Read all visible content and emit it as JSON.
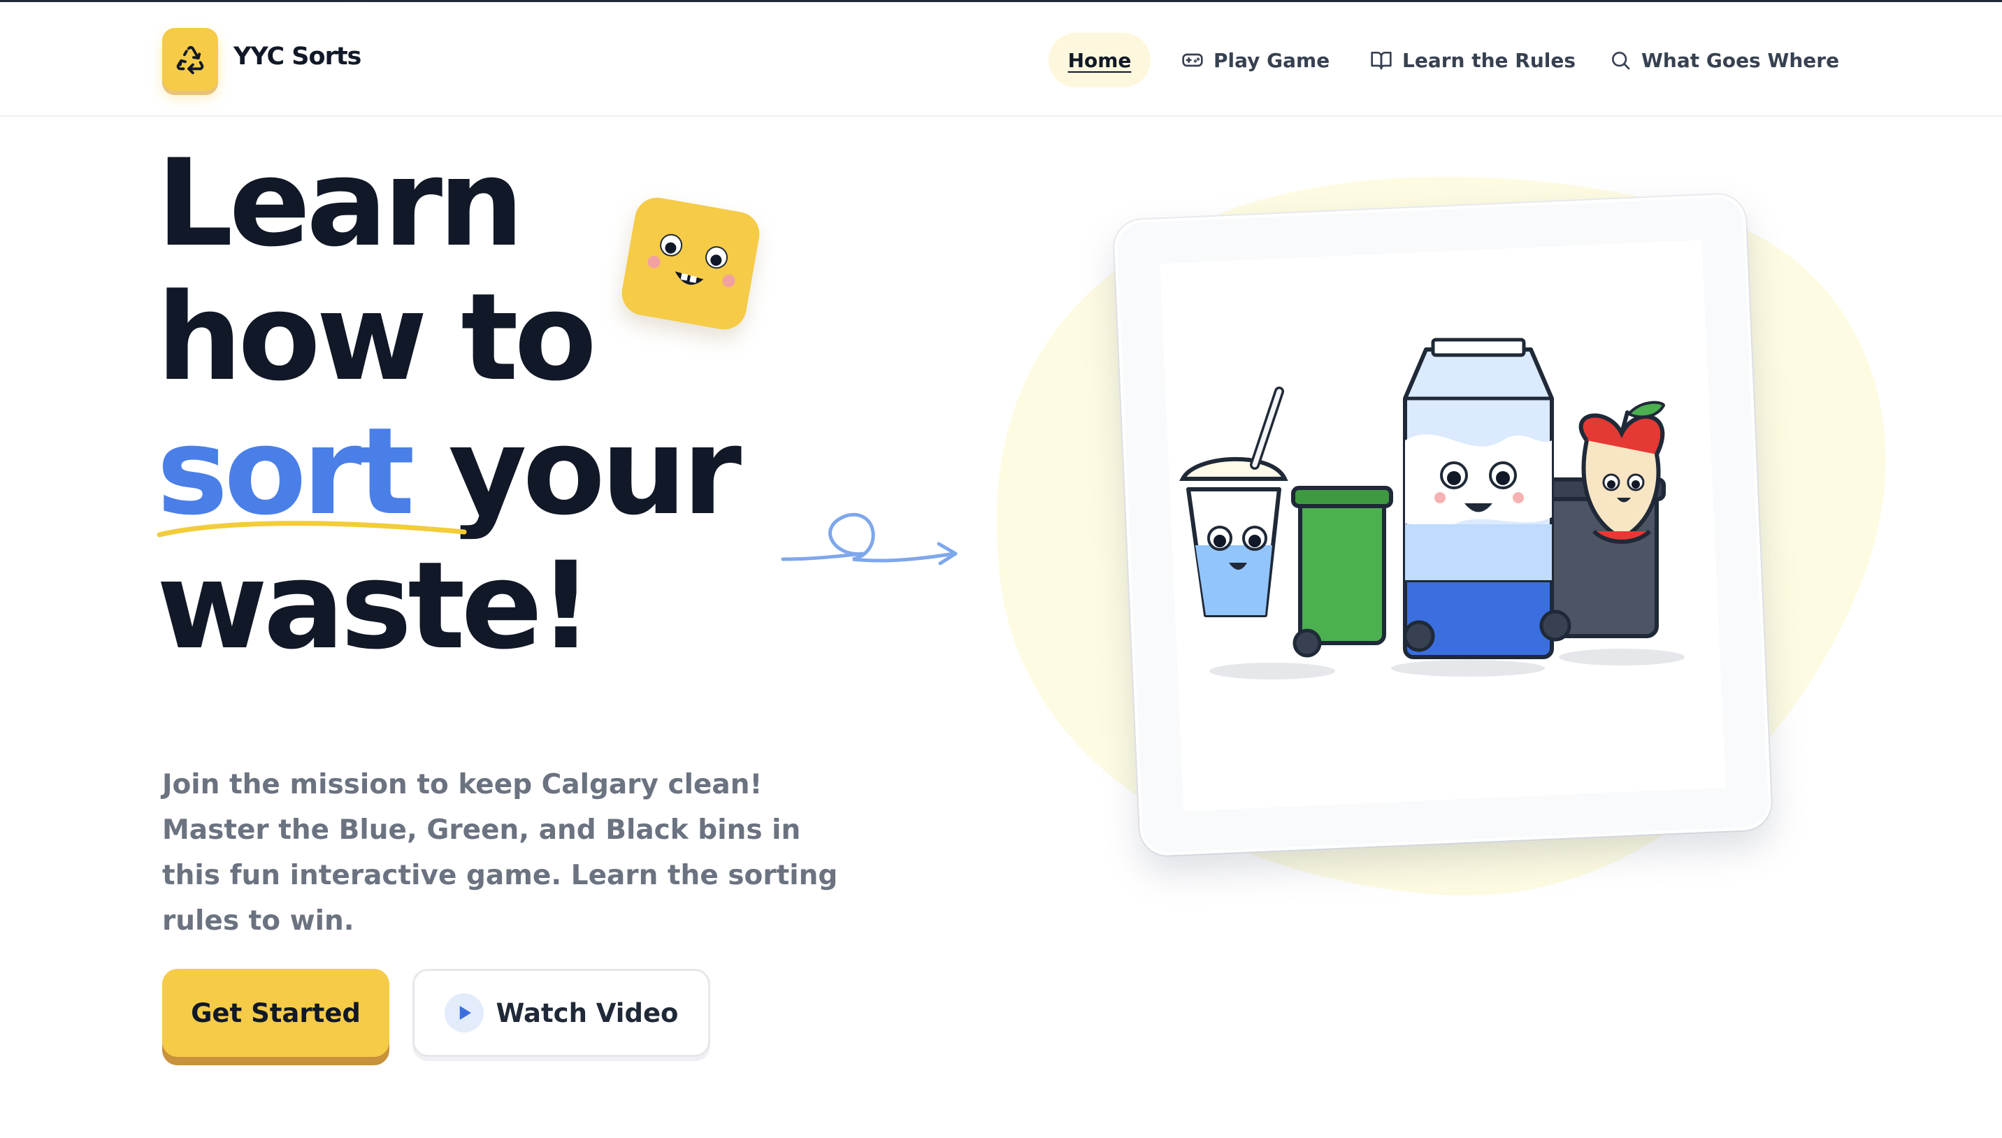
{
  "brand": {
    "name": "YYC Sorts",
    "icon": "recycle-icon",
    "color": "#f5cb47"
  },
  "nav": {
    "items": [
      {
        "label": "Home",
        "icon": "",
        "active": true
      },
      {
        "label": "Play Game",
        "icon": "gamepad-icon"
      },
      {
        "label": "Learn the Rules",
        "icon": "book-icon"
      },
      {
        "label": "What Goes Where",
        "icon": "search-icon"
      }
    ]
  },
  "hero": {
    "line1": "Learn",
    "line2": "how to",
    "line3_highlight": "sort",
    "line3_rest": " your",
    "line4": "waste!",
    "subtitle": "Join the mission to keep Calgary clean! Master the Blue, Green, and Black bins in this fun interactive game. Learn the sorting rules to win.",
    "primary_button": "Get Started",
    "secondary_button": "Watch Video",
    "mascot": "smiley-cube-icon",
    "illustration": "bin-characters-illustration"
  },
  "colors": {
    "accent_blue": "#4a7fe8",
    "accent_yellow": "#f5cb47",
    "text_dark": "#111827",
    "text_muted": "#6b7280",
    "blob": "#fdfbe1"
  }
}
